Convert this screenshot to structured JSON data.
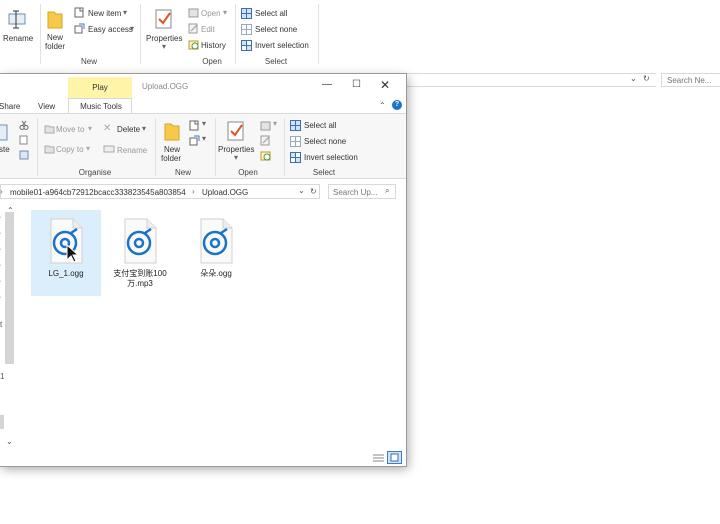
{
  "back_window": {
    "ribbon": {
      "rename": "Rename",
      "new_folder": "New\nfolder",
      "new_item": "New item",
      "easy_access": "Easy access",
      "properties": "Properties",
      "open": "Open",
      "edit": "Edit",
      "history": "History",
      "select_all": "Select all",
      "select_none": "Select none",
      "invert_selection": "Invert selection",
      "groups": {
        "new": "New",
        "open": "Open",
        "select": "Select"
      }
    },
    "search_placeholder": "Search Ne..."
  },
  "front_window": {
    "title": "Upload.OGG",
    "context_tab": "Play",
    "tabs": {
      "share": "Share",
      "view": "View",
      "music_tools": "Music Tools"
    },
    "ribbon": {
      "paste": "ste",
      "move_to": "Move to",
      "copy_to": "Copy to",
      "delete": "Delete",
      "rename": "Rename",
      "new_folder_line1": "New",
      "new_folder_line2": "folder",
      "properties": "Properties",
      "select_all": "Select all",
      "select_none": "Select none",
      "invert_selection": "Invert selection",
      "groups": {
        "organise": "Organise",
        "new": "New",
        "open": "Open",
        "select": "Select"
      }
    },
    "address": {
      "path": [
        "mobile01-a964cb72912bcacc333823545a803854",
        "Upload.OGG"
      ]
    },
    "search_placeholder": "Search Up...",
    "files": [
      {
        "name": "LG_1.ogg",
        "selected": true
      },
      {
        "name": "支付宝到账100万.mp3",
        "selected": false
      },
      {
        "name": "朵朵.ogg",
        "selected": false
      }
    ],
    "nav_pane": {
      "fragment_1": "t",
      "fragment_2": "1"
    },
    "colors": {
      "accent": "#1a73c8",
      "context_tab": "#fff4a8",
      "selection": "#dbeefb"
    },
    "icons": {
      "file": "audio-disc-icon",
      "cursor": "mouse-pointer-icon"
    }
  }
}
